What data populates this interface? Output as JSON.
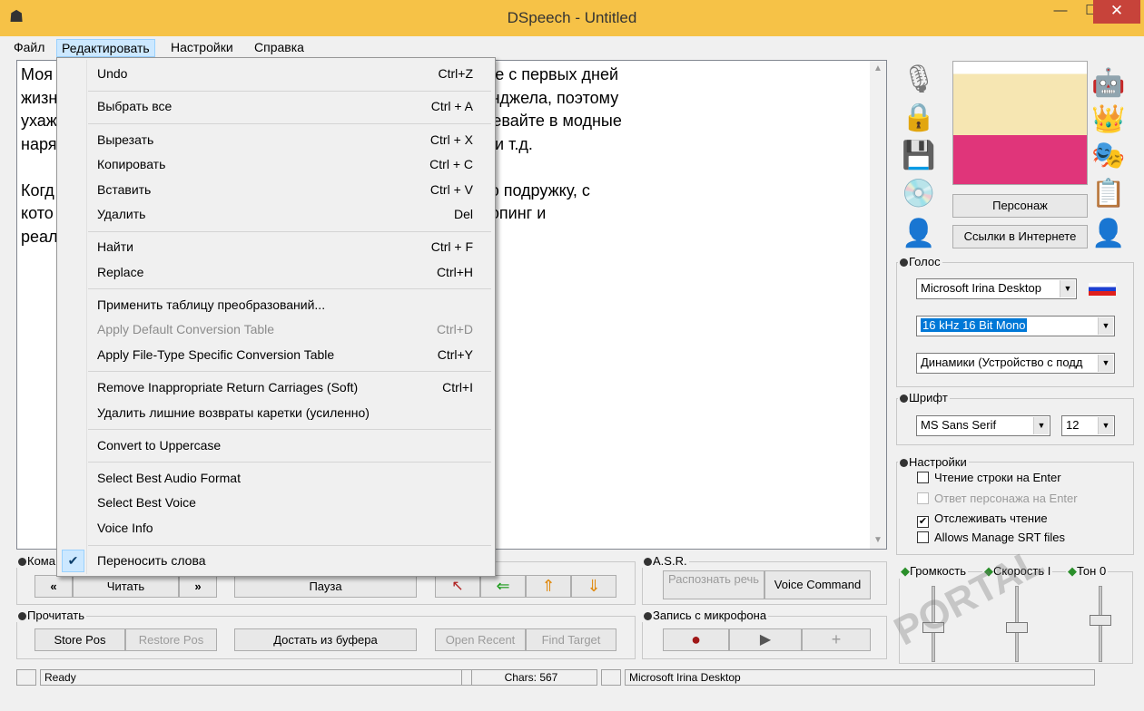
{
  "window": {
    "title": "DSpeech - Untitled",
    "controls": {
      "minimize": "—",
      "maximize": "☐",
      "close": "✕"
    }
  },
  "menubar": [
    "Файл",
    "Редактировать",
    "Настройки",
    "Справка"
  ],
  "editor": {
    "line1": "Моя                                                       ошечку и воспитывайте ее с первых дней",
    "line2": "жизн                                                      с зависит какой станет Анджела, поэтому",
    "line3": "ухаж                                                      самой полезной едой, одевайте в модные",
    "line4": "наря                                                      вные развивающие игры и т.д.",
    "line5": "",
    "line6": "Когд                                                      стоящую леди и отличную подружку, с",
    "line7": "кото                                                      ми, и устроить модный шопинг и",
    "line8": "реал"
  },
  "edit_menu": {
    "items": [
      {
        "label": "Undo",
        "shortcut": "Ctrl+Z"
      },
      {
        "label": "Выбрать все",
        "shortcut": "Ctrl + A"
      },
      {
        "label": "Вырезать",
        "shortcut": "Ctrl + X"
      },
      {
        "label": "Копировать",
        "shortcut": "Ctrl + C"
      },
      {
        "label": "Вставить",
        "shortcut": "Ctrl + V"
      },
      {
        "label": "Удалить",
        "shortcut": "Del"
      },
      {
        "label": "Найти",
        "shortcut": "Ctrl + F"
      },
      {
        "label": "Replace",
        "shortcut": "Ctrl+H"
      },
      {
        "label": "Применить таблицу преобразований...",
        "shortcut": ""
      },
      {
        "label": "Apply Default Conversion Table",
        "shortcut": "Ctrl+D"
      },
      {
        "label": "Apply File-Type Specific Conversion Table",
        "shortcut": "Ctrl+Y"
      },
      {
        "label": "Remove Inappropriate Return Carriages (Soft)",
        "shortcut": "Ctrl+I"
      },
      {
        "label": "Удалить лишние возвраты каретки (усиленно)",
        "shortcut": ""
      },
      {
        "label": "Convert to Uppercase",
        "shortcut": ""
      },
      {
        "label": "Select Best Audio Format",
        "shortcut": ""
      },
      {
        "label": "Select Best Voice",
        "shortcut": ""
      },
      {
        "label": "Voice Info",
        "shortcut": ""
      },
      {
        "label": "Переносить слова",
        "shortcut": ""
      }
    ]
  },
  "right_panel": {
    "character_label": "Персонаж",
    "links_button": "Ссылки в Интернете",
    "voice_group": "Голос",
    "voice_select": "Microsoft Irina Desktop",
    "format_select": "16 kHz 16 Bit Mono",
    "device_select": "Динамики (Устройство с подд",
    "font_group": "Шрифт",
    "font_select": "MS Sans Serif",
    "size_select": "12",
    "settings_group": "Настройки",
    "settings": [
      {
        "label": "Чтение строки на Enter",
        "checked": false,
        "disabled": false
      },
      {
        "label": "Ответ персонажа на Enter",
        "checked": false,
        "disabled": true
      },
      {
        "label": "Отслеживать чтение",
        "checked": true,
        "disabled": false
      },
      {
        "label": "Allows Manage SRT files",
        "checked": false,
        "disabled": false
      }
    ],
    "sliders": {
      "volume": "Громкость",
      "speed": "Скорость I",
      "tone": "Тон 0"
    }
  },
  "bottom": {
    "commands_group": "Кома",
    "prev": "«",
    "read": "Читать",
    "next": "»",
    "pause": "Пауза",
    "asr_group": "A.S.R.",
    "recognize": "Распознать речь",
    "voice_command": "Voice Command",
    "read_group": "Прочитать",
    "store_pos": "Store Pos",
    "restore_pos": "Restore Pos",
    "from_clipboard": "Достать из буфера",
    "open_recent": "Open Recent",
    "find_target": "Find Target",
    "mic_group": "Запись с микрофона"
  },
  "statusbar": {
    "status": "Ready",
    "chars": "Chars: 567",
    "voice": "Microsoft Irina Desktop"
  },
  "watermark": "PORTAL",
  "colors": {
    "titlebar": "#f6c247",
    "close": "#c7433a",
    "menu_highlight": "#cce8ff",
    "selection": "#0078d7"
  }
}
